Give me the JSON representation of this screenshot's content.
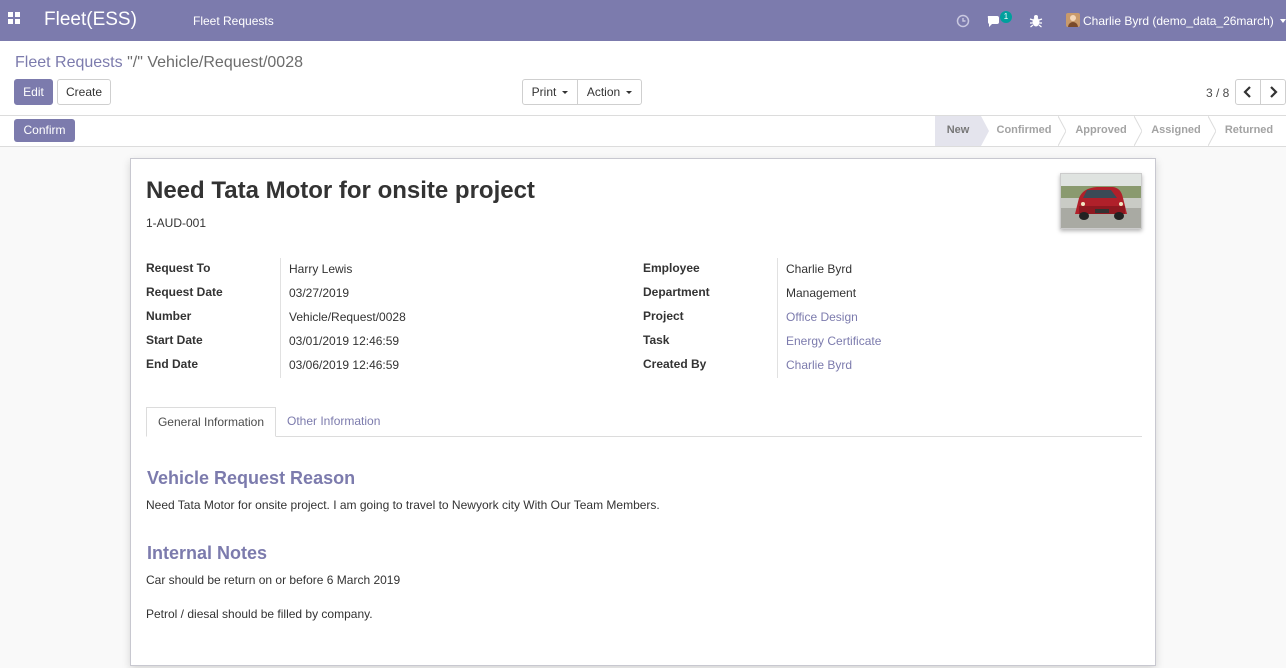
{
  "navbar": {
    "brand": "Fleet(ESS)",
    "menu_item": "Fleet Requests",
    "notification_count": "1",
    "user_name": "Charlie Byrd (demo_data_26march)"
  },
  "breadcrumb": {
    "parent": "Fleet Requests",
    "separator": "\"/\"",
    "current": "Vehicle/Request/0028"
  },
  "toolbar": {
    "edit_label": "Edit",
    "create_label": "Create",
    "print_label": "Print",
    "action_label": "Action"
  },
  "pager": {
    "value": "3 / 8"
  },
  "statusbar": {
    "confirm_label": "Confirm",
    "stages": [
      "New",
      "Confirmed",
      "Approved",
      "Assigned",
      "Returned"
    ],
    "active_stage": "New"
  },
  "record": {
    "title": "Need Tata Motor for onsite project",
    "code": "1-AUD-001",
    "left_fields": [
      {
        "label": "Request To",
        "value": "Harry Lewis"
      },
      {
        "label": "Request Date",
        "value": "03/27/2019"
      },
      {
        "label": "Number",
        "value": "Vehicle/Request/0028"
      },
      {
        "label": "Start Date",
        "value": "03/01/2019 12:46:59"
      },
      {
        "label": "End Date",
        "value": "03/06/2019 12:46:59"
      }
    ],
    "right_fields": [
      {
        "label": "Employee",
        "value": "Charlie Byrd"
      },
      {
        "label": "Department",
        "value": "Management"
      },
      {
        "label": "Project",
        "value": "Office Design"
      },
      {
        "label": "Task",
        "value": "Energy Certificate"
      },
      {
        "label": "Created By",
        "value": "Charlie Byrd"
      }
    ]
  },
  "tabs": {
    "general": "General Information",
    "other": "Other Information"
  },
  "content": {
    "reason_title": "Vehicle Request Reason",
    "reason_text": "Need Tata Motor for onsite project. I am going to travel to Newyork city With Our Team Members.",
    "notes_title": "Internal Notes",
    "notes_line1": "Car should be return on or before 6 March 2019",
    "notes_line2": "Petrol / diesal should be filled by company."
  },
  "colors": {
    "brand": "#7c7bad",
    "badge": "#00a09d"
  }
}
